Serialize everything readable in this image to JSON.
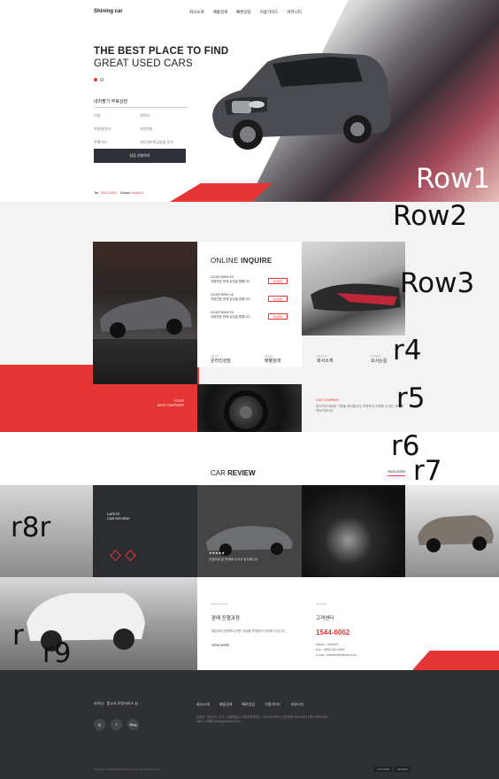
{
  "header": {
    "logo": "Shining car",
    "nav": [
      "회사소개",
      "매물검색",
      "빠른상담",
      "이용가이드",
      "커뮤니티"
    ]
  },
  "hero": {
    "title_line1": "THE BEST PLACE TO FIND",
    "title_line2": "GREAT USED CARS",
    "form_title": "내차팔기 무료상담",
    "fields_left": [
      "이름",
      "차량명/연식",
      "주행거리"
    ],
    "fields_right": [
      "연락처",
      "차량번호",
      "개인정보취급방침 동의"
    ],
    "submit": "상담 신청하기",
    "tel_label": "Tel.",
    "tel": "1544-6062",
    "kakao_label": "Kakao",
    "kakao": "moko24"
  },
  "labels": {
    "row1": "Row1",
    "row2": "Row2",
    "row3": "Row3",
    "r4": "r4",
    "r5": "r5",
    "r6": "r6",
    "r7": "r7",
    "r8": "r8r",
    "r9a": "r",
    "r9b": "r9"
  },
  "inquire": {
    "title_light": "ONLINE",
    "title_bold": "INQUIRE",
    "items": [
      {
        "line1": "2018년 BMW X5",
        "line2": "차량번호 판매 상담을 원합니다.",
        "badge": "상담완료"
      },
      {
        "line1": "2018년 BMW X5",
        "line2": "차량번호 판매 상담을 원합니다.",
        "badge": "상담완료"
      },
      {
        "line1": "2018년 BMW X5",
        "line2": "차량번호 판매 상담을 원합니다.",
        "badge": "상담완료"
      }
    ]
  },
  "quick_links": [
    {
      "en": "Inquire",
      "ko": "온라인상담"
    },
    {
      "en": "Search",
      "ko": "매물검색"
    },
    {
      "en": "About us",
      "ko": "회사소개"
    },
    {
      "en": "Location",
      "ko": "오시는길"
    }
  ],
  "partner": {
    "line1": "YOUR",
    "line2": "BEST PARTNER"
  },
  "company": {
    "title": "OUR COMPANY",
    "text": "중고차의 새로운 기준을 제시합니다. 투명하고 신뢰할 수 있는 거래를 약속드립니다."
  },
  "review": {
    "title_light": "CAR",
    "title_bold": "REVIEW",
    "view_more": "VIEW MORE",
    "latest_line1": "LATEST",
    "latest_line2": "CAR REVIEW",
    "stars": "★★★★★",
    "desc": "친절하게 잘 판매해 주셔서 감사합니다."
  },
  "cards": {
    "process_small": "sales process",
    "process_title": "판매 진행과정",
    "process_text": "매입부터 판매까지 모든 과정을 투명하게 안내해 드립니다.",
    "process_more": "VIEW MORE",
    "cs_small": "cs center",
    "cs_title": "고객센터",
    "phone": "1544-6062",
    "kakao": "Kakao : moko24",
    "fax": "Fax : 0505-300-4500",
    "email": "e-mail : fullweb@fullweb.co.kr"
  },
  "footer": {
    "brand": "샤이닝 · 중고차 토탈서비스 샵",
    "nav": [
      "회사소개",
      "매물검색",
      "빠른상담",
      "이용가이드",
      "커뮤니티"
    ],
    "social": [
      "◎",
      "f",
      "Blog"
    ],
    "info": "상호명 : 샤이닝카 | 주소 : 서울특별시 | 사업자등록번호 : 123-45-67890 | 대표전화 1544-6062 | 팩스 0505-300-4500 | 이메일 fullweb@fullweb.co.kr",
    "copyright": "Copyright © adc1004.shiningcorp.com All rights reserved.",
    "tags": [
      "FULLWEB",
      "SEARCH"
    ]
  },
  "colors": {
    "accent": "#e53535",
    "dark": "#2f3034"
  }
}
